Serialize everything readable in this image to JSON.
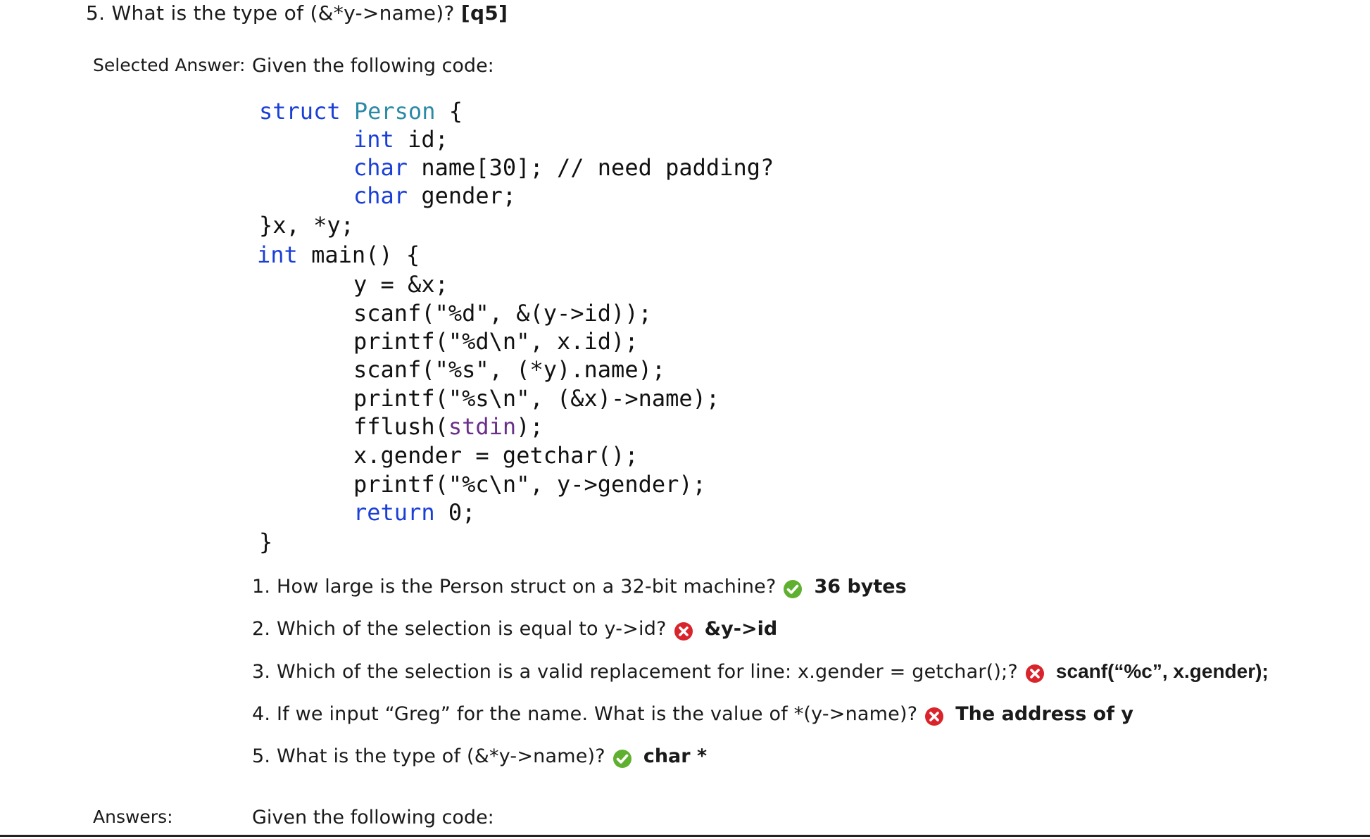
{
  "question": {
    "title": "5. What is the type of (&*y->name)?",
    "tag": "[q5]"
  },
  "selected_answer": {
    "label": "Selected Answer:",
    "intro": "Given the following code:",
    "code": [
      {
        "indent": 0,
        "parts": [
          {
            "t": "struct",
            "c": "kw"
          },
          {
            "t": " "
          },
          {
            "t": "Person",
            "c": "type"
          },
          {
            "t": " {"
          }
        ]
      },
      {
        "indent": 1,
        "parts": [
          {
            "t": "int",
            "c": "kw"
          },
          {
            "t": " id;"
          }
        ]
      },
      {
        "indent": 1,
        "parts": [
          {
            "t": "char",
            "c": "kw"
          },
          {
            "t": " name[30]; // need padding?"
          }
        ]
      },
      {
        "indent": 1,
        "parts": [
          {
            "t": "char",
            "c": "kw"
          },
          {
            "t": " gender;"
          }
        ]
      },
      {
        "indent": 0,
        "parts": [
          {
            "t": "}x, *y;"
          }
        ]
      },
      {
        "indent": 0,
        "parts": [
          {
            "t": "int",
            "c": "kw"
          },
          {
            "t": " main() {"
          }
        ]
      },
      {
        "indent": 1,
        "parts": [
          {
            "t": "y = &x;"
          }
        ]
      },
      {
        "indent": 1,
        "parts": [
          {
            "t": "scanf(\"%d\", &(y->id));"
          }
        ]
      },
      {
        "indent": 1,
        "parts": [
          {
            "t": "printf(\"%d\\n\", x.id);"
          }
        ]
      },
      {
        "indent": 1,
        "parts": [
          {
            "t": "scanf(\"%s\", (*y).name);"
          }
        ]
      },
      {
        "indent": 1,
        "parts": [
          {
            "t": "printf(\"%s\\n\", (&x)->name);"
          }
        ]
      },
      {
        "indent": 1,
        "parts": [
          {
            "t": "fflush("
          },
          {
            "t": "stdin",
            "c": "ident"
          },
          {
            "t": ");"
          }
        ]
      },
      {
        "indent": 1,
        "parts": [
          {
            "t": "x.gender = getchar();"
          }
        ]
      },
      {
        "indent": 1,
        "parts": [
          {
            "t": "printf(\"%c\\n\", y->gender);"
          }
        ]
      },
      {
        "indent": 1,
        "parts": [
          {
            "t": "return",
            "c": "kw"
          },
          {
            "t": " 0;"
          }
        ]
      },
      {
        "indent": 0,
        "parts": [
          {
            "t": "}"
          }
        ]
      }
    ],
    "items": [
      {
        "question": "1. How large is the Person struct on a 32-bit machine?",
        "status": "correct",
        "answer": "36 bytes",
        "answer_style": "normal"
      },
      {
        "question": "2. Which of the selection is equal to y->id?",
        "status": "incorrect",
        "answer": "&y->id",
        "answer_style": "normal"
      },
      {
        "question": "3. Which of the selection is a valid replacement for line: x.gender = getchar();?",
        "status": "incorrect",
        "answer": "scanf(“%c”, x.gender);",
        "answer_style": "serif"
      },
      {
        "question": "4. If we input “Greg” for the name. What is the value of *(y->name)?",
        "status": "incorrect",
        "answer": "The address of y",
        "answer_style": "normal"
      },
      {
        "question": "5. What is the type of (&*y->name)?",
        "status": "correct",
        "answer": "char *",
        "answer_style": "normal"
      }
    ]
  },
  "answers": {
    "label": "Answers:",
    "intro": "Given the following code:"
  },
  "colors": {
    "keyword": "#1a3fd6",
    "type": "#2b8aa6",
    "identifier": "#6b2f8a",
    "correct": "#5fb030",
    "incorrect": "#d8242a"
  }
}
